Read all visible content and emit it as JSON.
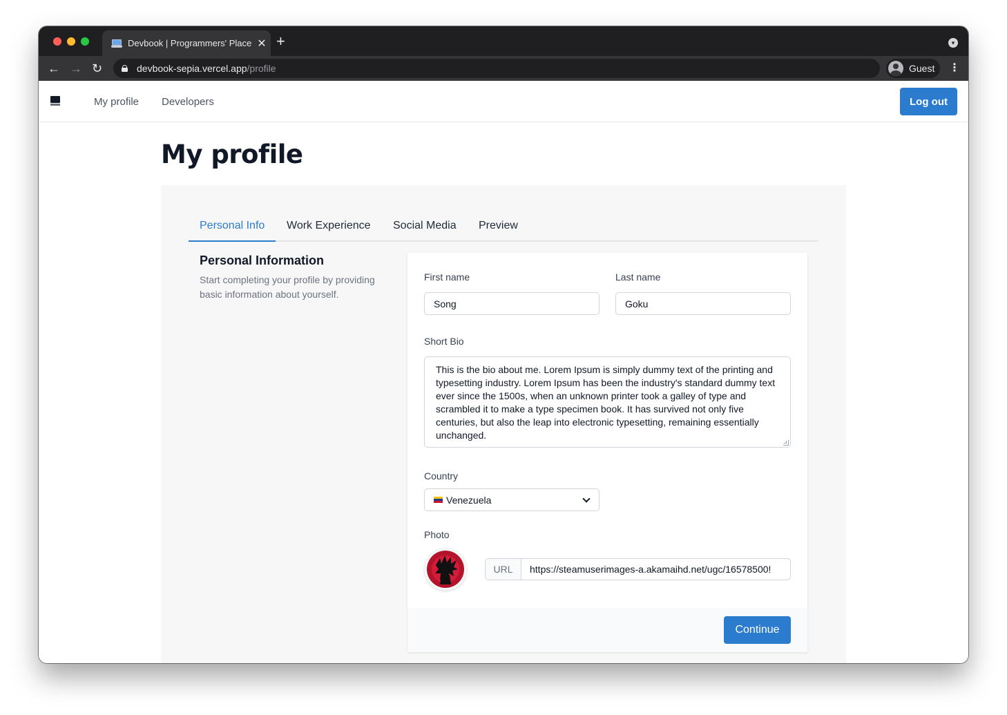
{
  "browser": {
    "tab_title": "Devbook | Programmers' Place",
    "tab_close": "✕",
    "new_tab": "+",
    "url_host": "devbook-sepia.vercel.app",
    "url_path": "/profile",
    "profile_name": "Guest",
    "back_glyph": "←",
    "forward_glyph": "→",
    "reload_glyph": "↻",
    "menu_glyph": "⋮",
    "tabstrip_menu_glyph": "▾"
  },
  "navbar": {
    "links": [
      "My profile",
      "Developers"
    ],
    "logout_label": "Log out"
  },
  "page": {
    "title": "My profile"
  },
  "tabs": [
    {
      "label": "Personal Info",
      "active": true
    },
    {
      "label": "Work Experience",
      "active": false
    },
    {
      "label": "Social Media",
      "active": false
    },
    {
      "label": "Preview",
      "active": false
    }
  ],
  "section": {
    "heading": "Personal Information",
    "description": "Start completing your profile by providing basic information about yourself."
  },
  "form": {
    "first_name_label": "First name",
    "first_name_value": "Song",
    "last_name_label": "Last name",
    "last_name_value": "Goku",
    "bio_label": "Short Bio",
    "bio_value": "This is the bio about me. Lorem Ipsum is simply dummy text of the printing and typesetting industry. Lorem Ipsum has been the industry's standard dummy text ever since the 1500s, when an unknown printer took a galley of type and scrambled it to make a type specimen book. It has survived not only five centuries, but also the leap into electronic typesetting, remaining essentially unchanged.",
    "country_label": "Country",
    "country_value": "Venezuela",
    "photo_label": "Photo",
    "url_addon": "URL",
    "url_value": "https://steamuserimages-a.akamaihd.net/ugc/16578500!",
    "continue_label": "Continue"
  },
  "colors": {
    "accent": "#2b7bcf",
    "panel_bg": "#f7f7f8"
  }
}
